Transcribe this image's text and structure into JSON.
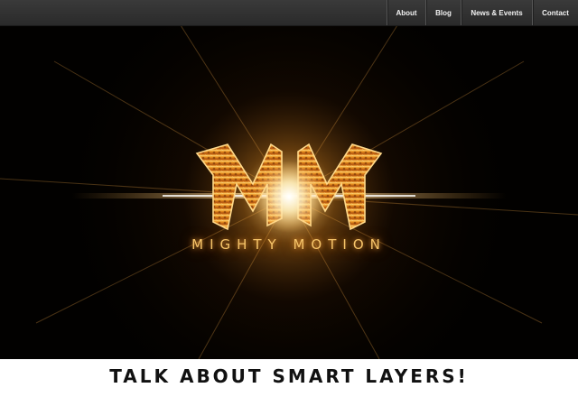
{
  "nav": {
    "items": [
      {
        "label": "About"
      },
      {
        "label": "Blog"
      },
      {
        "label": "News & Events"
      },
      {
        "label": "Contact"
      }
    ]
  },
  "hero": {
    "logo_monogram": "MM",
    "brand_name": "MIGHTY MOTION"
  },
  "tagline": "TALK ABOUT SMART LAYERS!",
  "colors": {
    "nav_background": "#2e2e2e",
    "hero_background": "#020100",
    "glow": "#ffd27a",
    "logo_gold": "#e08a1e",
    "brand_text": "#f7c56a",
    "tagline_text": "#111111"
  }
}
